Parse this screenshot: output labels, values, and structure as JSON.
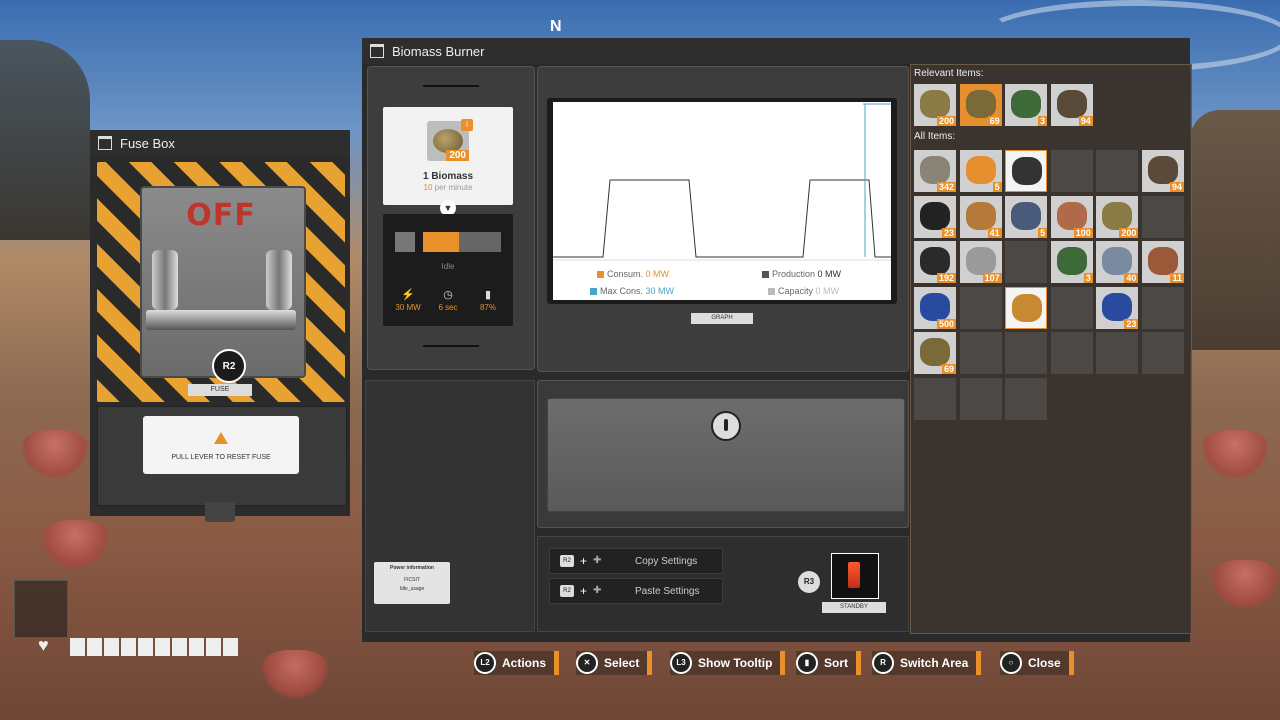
{
  "compass": {
    "heading": "N"
  },
  "fuse_box": {
    "title": "Fuse Box",
    "state_text": "OFF",
    "button_hint": "R2",
    "lever_label": "FUSE",
    "warning": "PULL LEVER TO RESET FUSE"
  },
  "window": {
    "title": "Biomass Burner"
  },
  "fuel": {
    "count": "200",
    "name": "1 Biomass",
    "rate_num": "10",
    "rate_suffix": " per minute",
    "status": "Idle",
    "stats": [
      {
        "icon": "lightning-icon",
        "glyph": "⚡",
        "value": "30 MW"
      },
      {
        "icon": "timer-icon",
        "glyph": "◷",
        "value": "6 sec"
      },
      {
        "icon": "bar-chart-icon",
        "glyph": "▮",
        "value": "87%"
      }
    ]
  },
  "graph": {
    "tab_label": "GRAPH",
    "legend": {
      "consum_label": "Consum.",
      "consum_value": "0 MW",
      "production_label": "Production",
      "production_value": "0 MW",
      "maxcons_label": "Max Cons.",
      "maxcons_value": "30 MW",
      "capacity_label": "Capacity",
      "capacity_value": "0 MW"
    },
    "colors": {
      "consum": "#e8902a",
      "production": "#555555",
      "maxcons": "#4aa3c8",
      "capacity": "#bbbbbb"
    }
  },
  "power_info": {
    "title": "Power information",
    "l1": "FICSIT",
    "l2": "Idle_usage"
  },
  "settings": {
    "copy": {
      "key": "R2",
      "label": "Copy Settings"
    },
    "paste": {
      "key": "R2",
      "label": "Paste Settings"
    }
  },
  "standby": {
    "key": "R3",
    "label": "STANDBY"
  },
  "inventory": {
    "relevant_title": "Relevant Items:",
    "all_title": "All Items:",
    "relevant": [
      {
        "count": "200",
        "color": "#8a7a45",
        "state": "filled"
      },
      {
        "count": "69",
        "color": "#7a6a3a",
        "state": "hl"
      },
      {
        "count": "3",
        "color": "#3e6a3a",
        "state": "filled"
      },
      {
        "count": "94",
        "color": "#5a4a3a",
        "state": "filled"
      }
    ],
    "all": [
      {
        "count": "342",
        "color": "#8a8478"
      },
      {
        "count": "5",
        "color": "#e58f2e"
      },
      {
        "count": "",
        "color": "#333333",
        "state": "white"
      },
      {
        "count": "",
        "color": ""
      },
      {
        "count": "",
        "color": ""
      },
      {
        "count": "94",
        "color": "#5a4a3a"
      },
      {
        "count": "23",
        "color": "#222222"
      },
      {
        "count": "41",
        "color": "#b5793a"
      },
      {
        "count": "5",
        "color": "#4a5a7a"
      },
      {
        "count": "100",
        "color": "#b06a4a"
      },
      {
        "count": "200",
        "color": "#8a7a45"
      },
      {
        "count": "",
        "color": ""
      },
      {
        "count": "192",
        "color": "#2a2a2a"
      },
      {
        "count": "107",
        "color": "#9a9a9a"
      },
      {
        "count": "",
        "color": ""
      },
      {
        "count": "3",
        "color": "#3e6a3a"
      },
      {
        "count": "40",
        "color": "#7a8aa0"
      },
      {
        "count": "11",
        "color": "#9a5a3a"
      },
      {
        "count": "500",
        "color": "#2a4aa0"
      },
      {
        "count": "",
        "color": ""
      },
      {
        "count": "",
        "color": "#c88a30",
        "state": "white"
      },
      {
        "count": "",
        "color": ""
      },
      {
        "count": "23",
        "color": "#2a4aa0"
      },
      {
        "count": "",
        "color": ""
      },
      {
        "count": "69",
        "color": "#7a6a3a"
      },
      {
        "count": "",
        "color": ""
      },
      {
        "count": "",
        "color": ""
      },
      {
        "count": "",
        "color": ""
      },
      {
        "count": "",
        "color": ""
      },
      {
        "count": "",
        "color": ""
      },
      {
        "count": "",
        "color": ""
      },
      {
        "count": "",
        "color": ""
      },
      {
        "count": "",
        "color": ""
      }
    ]
  },
  "prompts": [
    {
      "key": "L2",
      "label": "Actions"
    },
    {
      "key": "✕",
      "label": "Select"
    },
    {
      "key": "L3",
      "label": "Show Tooltip"
    },
    {
      "key": "▮",
      "label": "Sort"
    },
    {
      "key": "R",
      "label": "Switch Area"
    },
    {
      "key": "○",
      "label": "Close"
    }
  ]
}
